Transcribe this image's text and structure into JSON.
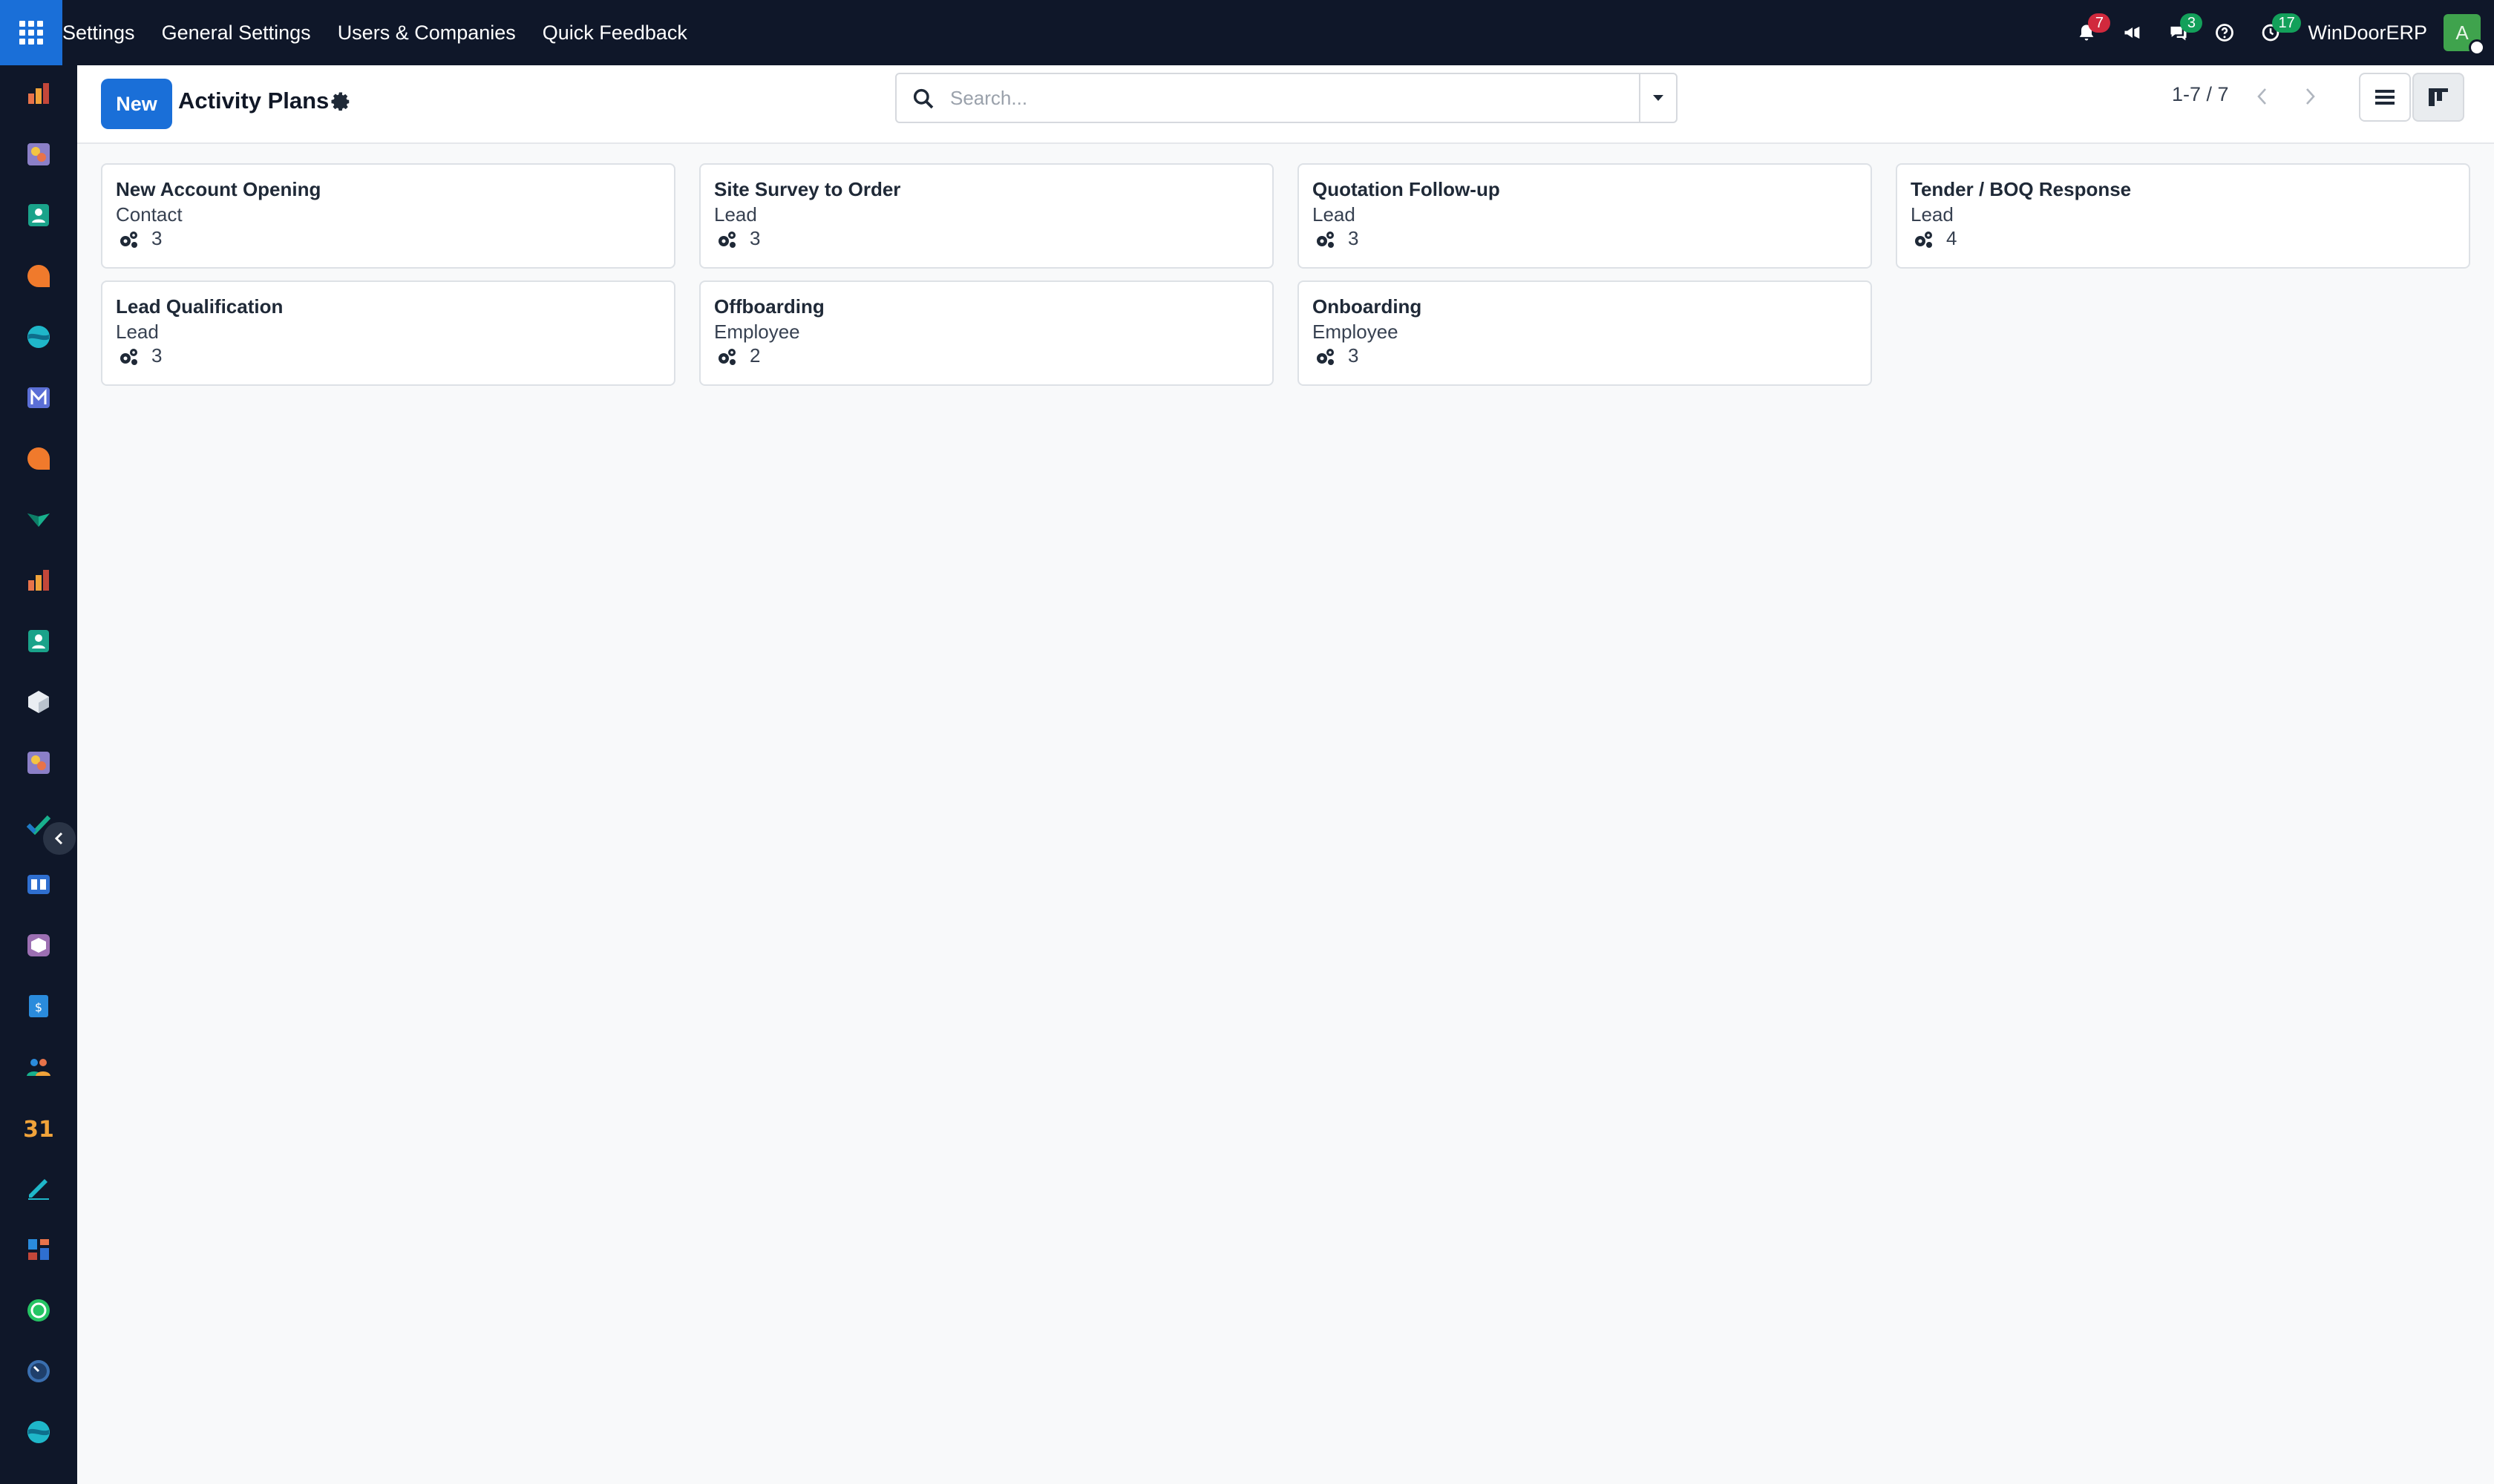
{
  "topbar": {
    "menu": [
      "Settings",
      "General Settings",
      "Users & Companies",
      "Quick Feedback"
    ],
    "notifications_count": "7",
    "messages_count": "3",
    "activities_count": "17",
    "company": "WinDoorERP",
    "avatar_initial": "A"
  },
  "sidebar": {
    "apps": [
      "sales-app-icon",
      "studio-app-icon",
      "contacts-app-icon",
      "discuss-app-icon",
      "website-app-icon",
      "email-marketing-app-icon",
      "livechat-app-icon",
      "knowledge-app-icon",
      "reporting-app-icon",
      "employees-app-icon",
      "inventory-app-icon",
      "studio-2-app-icon",
      "project-app-icon",
      "elearning-app-icon",
      "purchase-app-icon",
      "invoicing-app-icon",
      "recruitment-app-icon",
      "calendar-app-icon",
      "sign-app-icon",
      "dashboards-app-icon",
      "whatsapp-app-icon",
      "timesheets-app-icon",
      "website-2-app-icon"
    ]
  },
  "control": {
    "new_label": "New",
    "title": "Activity Plans",
    "search_placeholder": "Search...",
    "pager": "1-7 / 7"
  },
  "plans": [
    {
      "name": "New Account Opening",
      "model": "Contact",
      "count": "3"
    },
    {
      "name": "Site Survey to Order",
      "model": "Lead",
      "count": "3"
    },
    {
      "name": "Quotation Follow-up",
      "model": "Lead",
      "count": "3"
    },
    {
      "name": "Tender / BOQ Response",
      "model": "Lead",
      "count": "4"
    },
    {
      "name": "Lead Qualification",
      "model": "Lead",
      "count": "3"
    },
    {
      "name": "Offboarding",
      "model": "Employee",
      "count": "2"
    },
    {
      "name": "Onboarding",
      "model": "Employee",
      "count": "3"
    }
  ],
  "colors": {
    "primary": "#1a6fd8",
    "navbar": "#0f1729",
    "badge_red": "#d1293d",
    "badge_green": "#13a05a"
  }
}
